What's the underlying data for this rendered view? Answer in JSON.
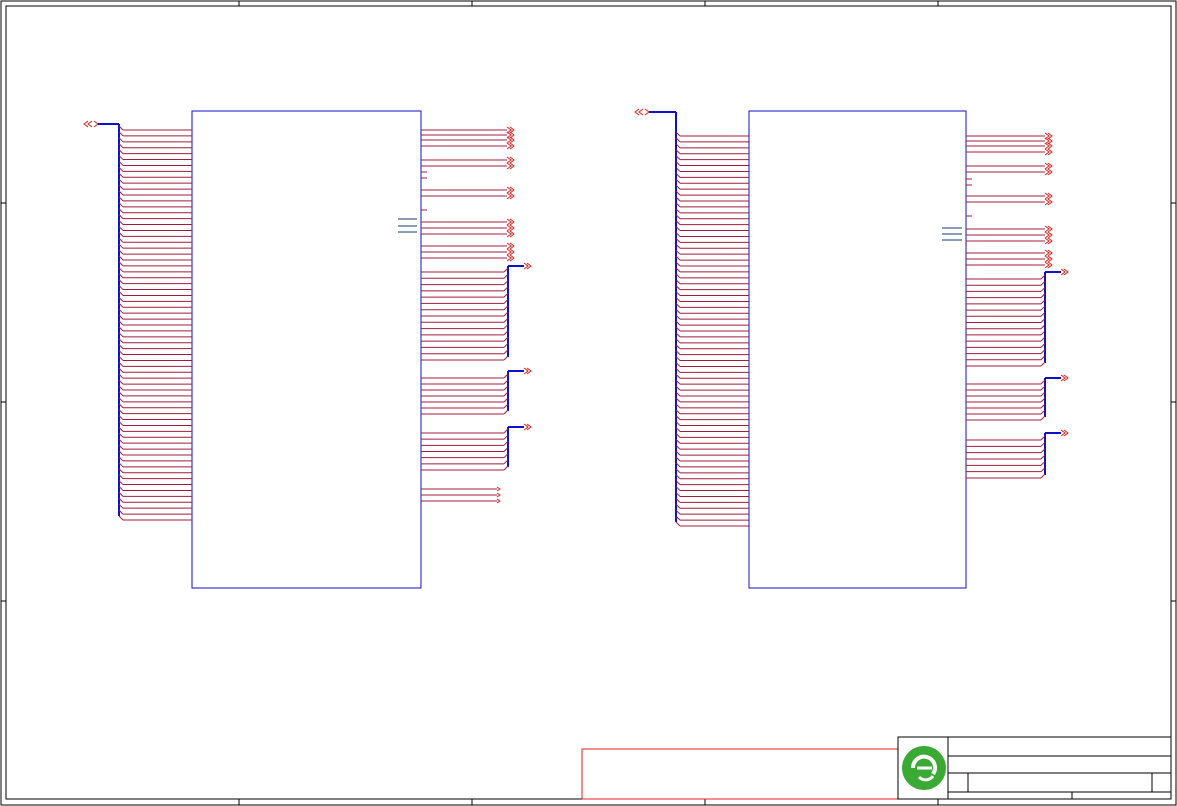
{
  "sheet": {
    "border_color": "#000000",
    "wire_color": "#a01c3c",
    "bus_color": "#1010c8",
    "component_color": "#1010c8",
    "port_color": "#e02020",
    "logo_color": "#3aaa35",
    "note_box_color": "#e02020"
  },
  "components": [
    {
      "name": "left-schematic-block",
      "left_pins": 67,
      "pin_label_visible": false
    },
    {
      "name": "right-schematic-block",
      "left_pins": 67,
      "pin_label_visible": false
    }
  ],
  "title_block": {
    "logo": "green-e-logo-icon",
    "title_text": "",
    "sheet_text": ""
  }
}
